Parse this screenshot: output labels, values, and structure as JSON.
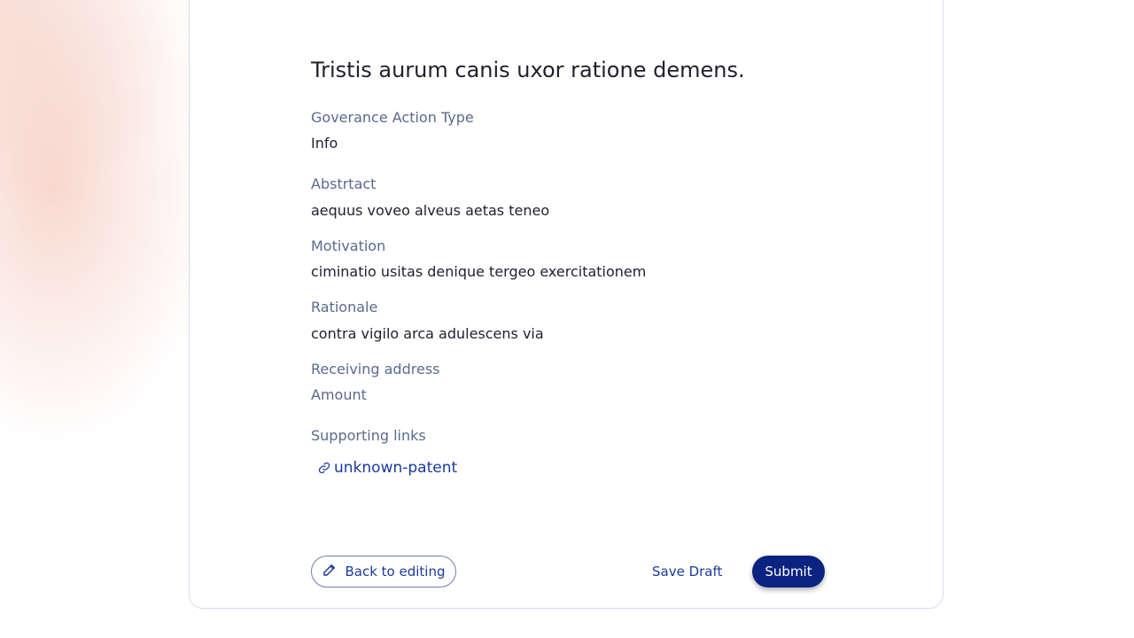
{
  "proposal": {
    "title": "Tristis aurum canis uxor ratione demens.",
    "fields": {
      "governance_action_type": {
        "label": "Goverance Action Type",
        "value": "Info"
      },
      "abstract": {
        "label": "Abstrtact",
        "value": "aequus voveo alveus aetas teneo"
      },
      "motivation": {
        "label": "Motivation",
        "value": "ciminatio usitas denique tergeo exercitationem"
      },
      "rationale": {
        "label": "Rationale",
        "value": "contra vigilo arca adulescens via"
      },
      "receiving_address": {
        "label": "Receiving address"
      },
      "amount": {
        "label": "Amount"
      },
      "supporting_links": {
        "label": "Supporting links",
        "links": [
          {
            "text": "unknown-patent",
            "icon": "link-icon"
          }
        ]
      }
    }
  },
  "actions": {
    "back_label": "Back to editing",
    "back_icon": "pencil-icon",
    "save_draft_label": "Save Draft",
    "submit_label": "Submit"
  },
  "colors": {
    "accent": "#0a2280",
    "link": "#1a3a9c",
    "label": "#5a6a8c"
  }
}
